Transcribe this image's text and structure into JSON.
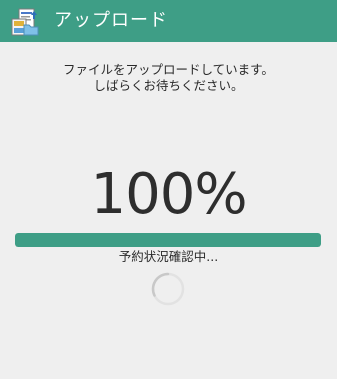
{
  "app_bar": {
    "title": "アップロード",
    "icon": "upload-app-icon",
    "color": "#3e9e86"
  },
  "message": {
    "line1": "ファイルをアップロードしています。",
    "line2": "しばらくお待ちください。"
  },
  "progress": {
    "percent_text": "100%",
    "fraction": 1.0,
    "fill_color": "#3e9e86"
  },
  "status": {
    "text": "予約状況確認中..."
  },
  "spinner": {
    "icon": "loading-spinner-icon"
  }
}
